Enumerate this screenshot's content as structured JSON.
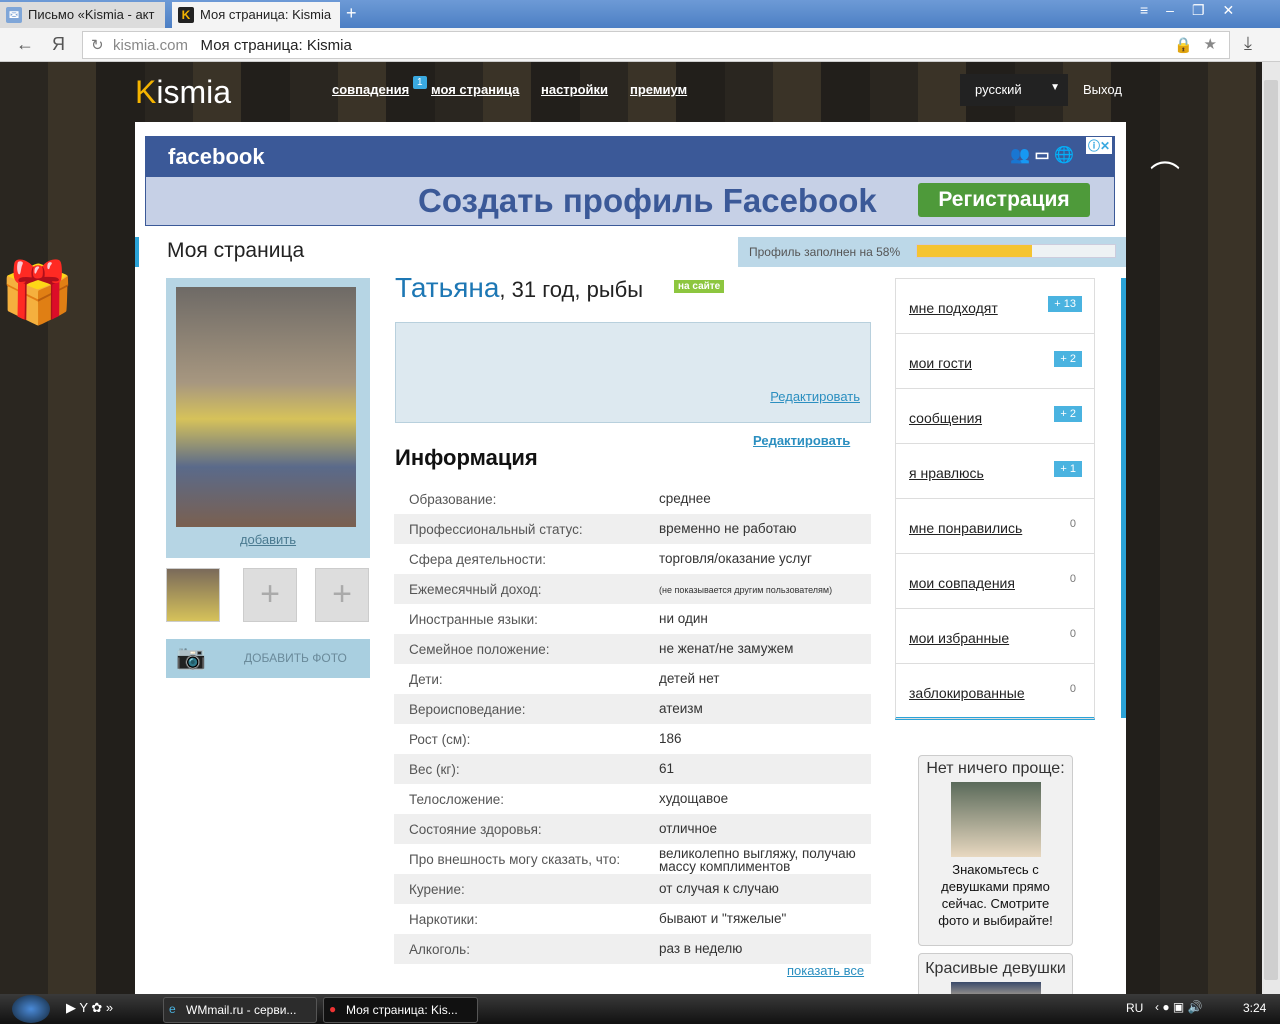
{
  "browser": {
    "tabs": [
      {
        "label": "Письмо «Kismia - акт"
      },
      {
        "label": "Моя страница: Kismia"
      }
    ],
    "url_domain": "kismia.com",
    "url_title": "Моя страница: Kismia"
  },
  "nav": {
    "logo": "Kismia",
    "matches": "совпадения",
    "matches_badge": "1",
    "my_page": "моя страница",
    "settings": "настройки",
    "premium": "премиум",
    "language": "русский",
    "logout": "Выход"
  },
  "fb_ad": {
    "brand": "facebook",
    "text": "Создать профиль Facebook",
    "button": "Регистрация"
  },
  "page": {
    "title": "Моя страница",
    "progress_label": "Профиль заполнен на 58%",
    "progress": 0.58
  },
  "profile": {
    "name": "Татьяна",
    "details": ", 31 год, рыбы",
    "online": "на сайте",
    "add_link": "добавить",
    "add_photo": "ДОБАВИТЬ ФОТО",
    "edit1": "Редактировать",
    "edit2": "Редактировать",
    "info_title": "Информация",
    "show_all": "показать все",
    "rows": [
      {
        "l": "Образование:",
        "v": "среднее"
      },
      {
        "l": "Профессиональный статус:",
        "v": "временно не работаю"
      },
      {
        "l": "Сфера деятельности:",
        "v": "торговля/оказание услуг"
      },
      {
        "l": "Ежемесячный доход:",
        "v": "(не показывается другим пользователям)"
      },
      {
        "l": "Иностранные языки:",
        "v": "ни один"
      },
      {
        "l": "Семейное положение:",
        "v": "не женат/не замужем"
      },
      {
        "l": "Дети:",
        "v": "детей нет"
      },
      {
        "l": "Вероисповедание:",
        "v": "атеизм"
      },
      {
        "l": "Рост (см):",
        "v": "186"
      },
      {
        "l": "Вес (кг):",
        "v": "61"
      },
      {
        "l": "Телосложение:",
        "v": "худощавое"
      },
      {
        "l": "Состояние здоровья:",
        "v": "отличное"
      },
      {
        "l": "Про внешность могу сказать, что:",
        "v": "великолепно выгляжу, получаю массу комплиментов"
      },
      {
        "l": "Курение:",
        "v": "от случая к случаю"
      },
      {
        "l": "Наркотики:",
        "v": "бывают и \"тяжелые\""
      },
      {
        "l": "Алкоголь:",
        "v": "раз в неделю"
      }
    ]
  },
  "sidebar": [
    {
      "t": "мне подходят",
      "c": "+ 13"
    },
    {
      "t": "мои гости",
      "c": "+ 2"
    },
    {
      "t": "сообщения",
      "c": "+ 2"
    },
    {
      "t": "я нравлюсь",
      "c": "+ 1"
    },
    {
      "t": "мне понравились",
      "c": "0"
    },
    {
      "t": "мои совпадения",
      "c": "0"
    },
    {
      "t": "мои избранные",
      "c": "0"
    },
    {
      "t": "заблокированные",
      "c": "0"
    }
  ],
  "ads": {
    "a1_title": "Нет ничего проще:",
    "a1_text": "Знакомьтесь с девушками прямо сейчас. Смотрите фото и выбирайте!",
    "a2_title": "Красивые девушки"
  },
  "taskbar": {
    "items": [
      "WMmail.ru - серви...",
      "Моя страница: Kis..."
    ],
    "lang": "RU",
    "time": "3:24"
  }
}
